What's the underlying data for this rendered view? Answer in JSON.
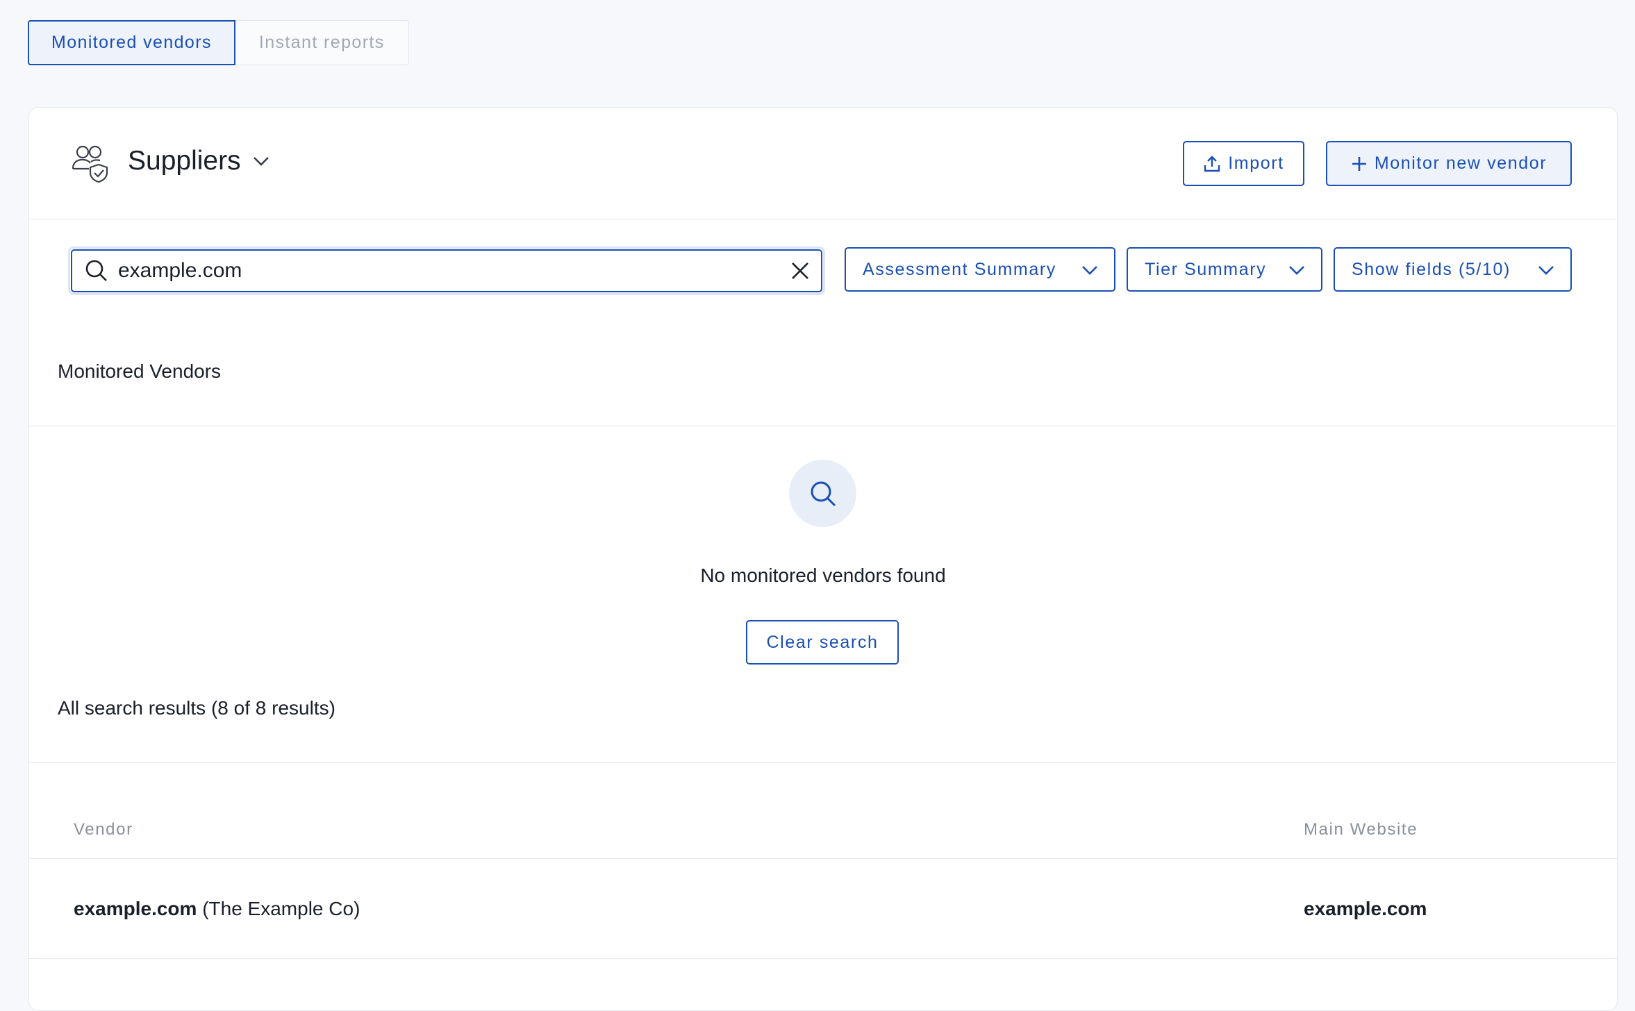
{
  "tabs": {
    "monitored": "Monitored vendors",
    "instant": "Instant reports"
  },
  "header": {
    "title": "Suppliers",
    "import_label": "Import",
    "monitor_label": "Monitor new vendor"
  },
  "search": {
    "value": "example.com"
  },
  "filters": {
    "assessment": "Assessment Summary",
    "tier": "Tier Summary",
    "fields": "Show fields (5/10)"
  },
  "monitored_section": {
    "title": "Monitored Vendors",
    "empty_text": "No monitored vendors found",
    "clear_label": "Clear search"
  },
  "results_section": {
    "title": "All search results (8 of 8 results)",
    "columns": [
      "Vendor",
      "Main Website"
    ],
    "rows": [
      {
        "vendor_domain": "example.com",
        "vendor_name": "(The Example Co)",
        "website": "example.com"
      }
    ]
  },
  "colors": {
    "accent": "#1a4fb3",
    "background": "#f7f8fb",
    "card": "#ffffff"
  }
}
